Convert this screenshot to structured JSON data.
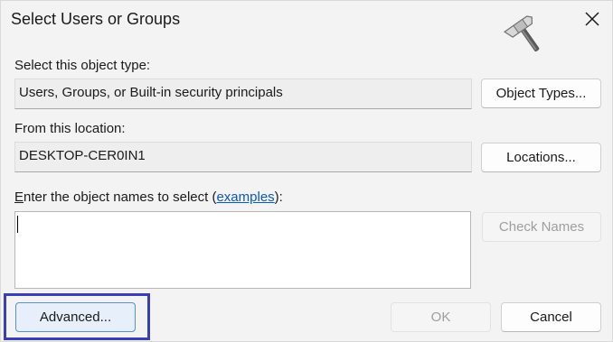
{
  "window": {
    "title": "Select Users or Groups",
    "close_icon": "close-icon",
    "logo_icon": "hammer-icon"
  },
  "object_type": {
    "label": "Select this object type:",
    "value": "Users, Groups, or Built-in security principals",
    "button": "Object Types..."
  },
  "location": {
    "label": "From this location:",
    "value": "DESKTOP-CER0IN1",
    "button": "Locations..."
  },
  "names": {
    "label_first_letter": "E",
    "label_rest": "nter the object names to select (",
    "link": "examples",
    "label_end": "):",
    "value": "",
    "check_button": "Check Names"
  },
  "footer": {
    "advanced_button": "Advanced...",
    "ok_button": "OK",
    "cancel_button": "Cancel"
  },
  "colors": {
    "highlight": "#3a3fb5",
    "link": "#0a58c2"
  }
}
